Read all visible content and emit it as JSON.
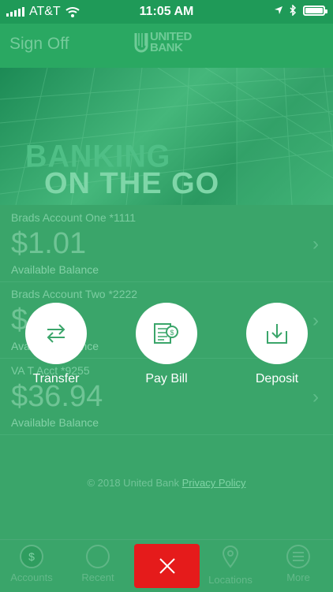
{
  "status_bar": {
    "carrier": "AT&T",
    "time": "11:05 AM"
  },
  "header": {
    "sign_off": "Sign Off",
    "logo_line1": "UNITED",
    "logo_line2": "BANK"
  },
  "hero": {
    "line1": "BANKING",
    "line2": "ON THE GO"
  },
  "accounts": [
    {
      "name": "Brads Account One *1111",
      "balance": "$1.01",
      "label": "Available Balance"
    },
    {
      "name": "Brads Account Two *2222",
      "balance": "$   .6",
      "label": "Available Balance"
    },
    {
      "name": "VA T    Acct *9255",
      "balance": "$36.94",
      "label": "Available Balance"
    }
  ],
  "footer": {
    "copyright": "© 2018 United Bank",
    "privacy": "Privacy Policy"
  },
  "quick_actions": [
    {
      "label": "Transfer",
      "icon": "transfer-icon"
    },
    {
      "label": "Pay Bill",
      "icon": "pay-bill-icon"
    },
    {
      "label": "Deposit",
      "icon": "deposit-icon"
    }
  ],
  "tabs": [
    {
      "label": "Accounts",
      "icon": "dollar-icon"
    },
    {
      "label": "Recent",
      "icon": "clock-icon"
    },
    {
      "label": "Locations",
      "icon": "location-pin-icon"
    },
    {
      "label": "More",
      "icon": "menu-icon"
    }
  ],
  "colors": {
    "brand_green": "#2aa862",
    "overlay_green": "#3aa56a",
    "close_red": "#e51b1b"
  }
}
